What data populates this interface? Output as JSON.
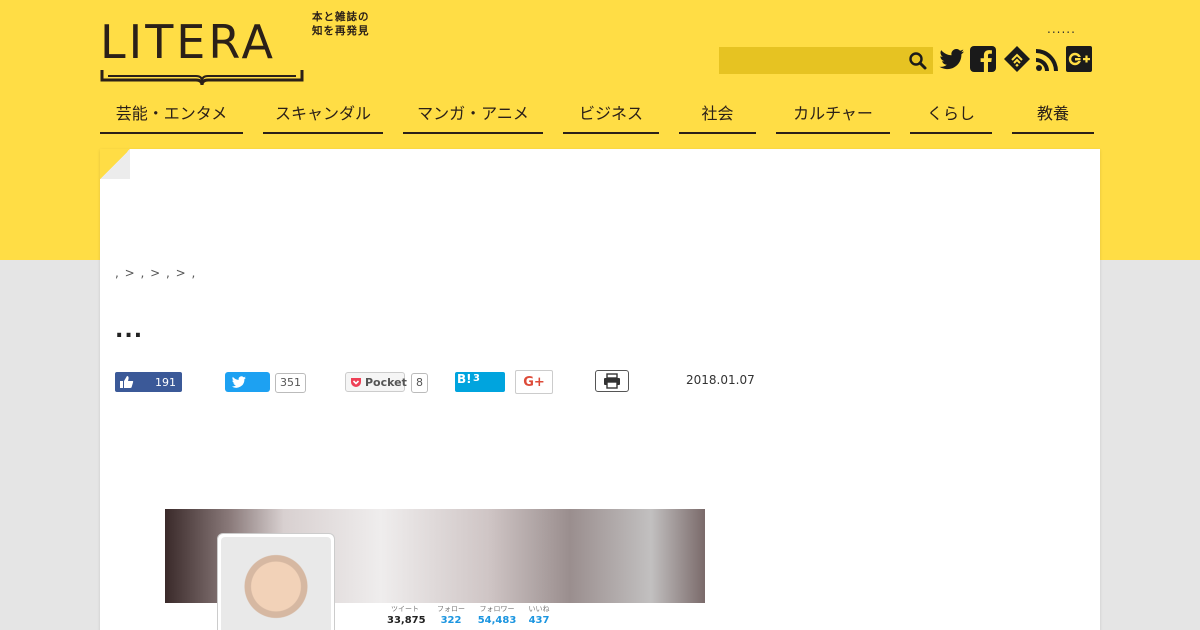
{
  "site": {
    "logo_text": "LITERA",
    "tagline_line1": "本と雑誌の",
    "tagline_line2": "知を再発見",
    "top_dots": "......"
  },
  "search": {
    "placeholder": "",
    "value": ""
  },
  "social_icons": [
    "twitter-icon",
    "facebook-icon",
    "feedly-icon",
    "rss-icon",
    "google-plus-icon"
  ],
  "nav": [
    {
      "label": "芸能・エンタメ"
    },
    {
      "label": "スキャンダル"
    },
    {
      "label": "マンガ・アニメ"
    },
    {
      "label": "ビジネス"
    },
    {
      "label": "社会"
    },
    {
      "label": "カルチャー"
    },
    {
      "label": "くらし"
    },
    {
      "label": "教養"
    }
  ],
  "article": {
    "breadcrumb": ", > , > , > ,",
    "title": "...",
    "date": "2018.01.07"
  },
  "share": {
    "facebook_count": "191",
    "twitter_count": "351",
    "pocket_label": "Pocket",
    "pocket_count": "8",
    "hatena_label": "B!",
    "hatena_count": "3",
    "gplus_label": "G+"
  },
  "twitter_profile": {
    "stats": [
      {
        "label": "ツイート",
        "value": "33,875"
      },
      {
        "label": "フォロー",
        "value": "322"
      },
      {
        "label": "フォロワー",
        "value": "54,483"
      },
      {
        "label": "いいね",
        "value": "437"
      }
    ]
  },
  "colors": {
    "brand_yellow": "#ffdd45",
    "ink": "#2b2018",
    "facebook": "#3b5998",
    "twitter": "#1da1f2",
    "hatena": "#00a4de"
  }
}
